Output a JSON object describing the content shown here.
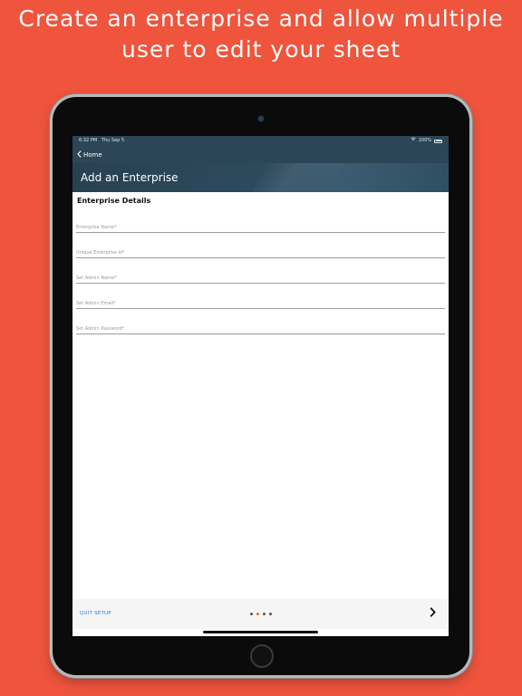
{
  "headline": "Create an enterprise and allow multiple\nuser to edit your sheet",
  "status": {
    "time": "6:32 PM",
    "date": "Thu Sep 5",
    "battery": "100%"
  },
  "nav": {
    "back_label": "Home"
  },
  "banner": {
    "title": "Add an Enterprise"
  },
  "form": {
    "section_title": "Enterprise Details",
    "fields": [
      {
        "placeholder": "Enterprise Name*",
        "value": ""
      },
      {
        "placeholder": "Unique Enterprise Id*",
        "value": ""
      },
      {
        "placeholder": "Set Admin Name*",
        "value": ""
      },
      {
        "placeholder": "Set Admin Email*",
        "value": ""
      },
      {
        "placeholder": "Set Admin Password*",
        "value": ""
      }
    ]
  },
  "footer": {
    "quit_label": "QUIT SETUP",
    "page_count": 4,
    "active_page": 2
  },
  "colors": {
    "background": "#ef543d",
    "header": "#2c4557",
    "link": "#2e7fd6",
    "active_dot": "#e56a2e"
  },
  "icons": {
    "back": "chevron-left-icon",
    "next": "chevron-right-icon",
    "wifi": "wifi-icon",
    "battery": "battery-icon"
  }
}
